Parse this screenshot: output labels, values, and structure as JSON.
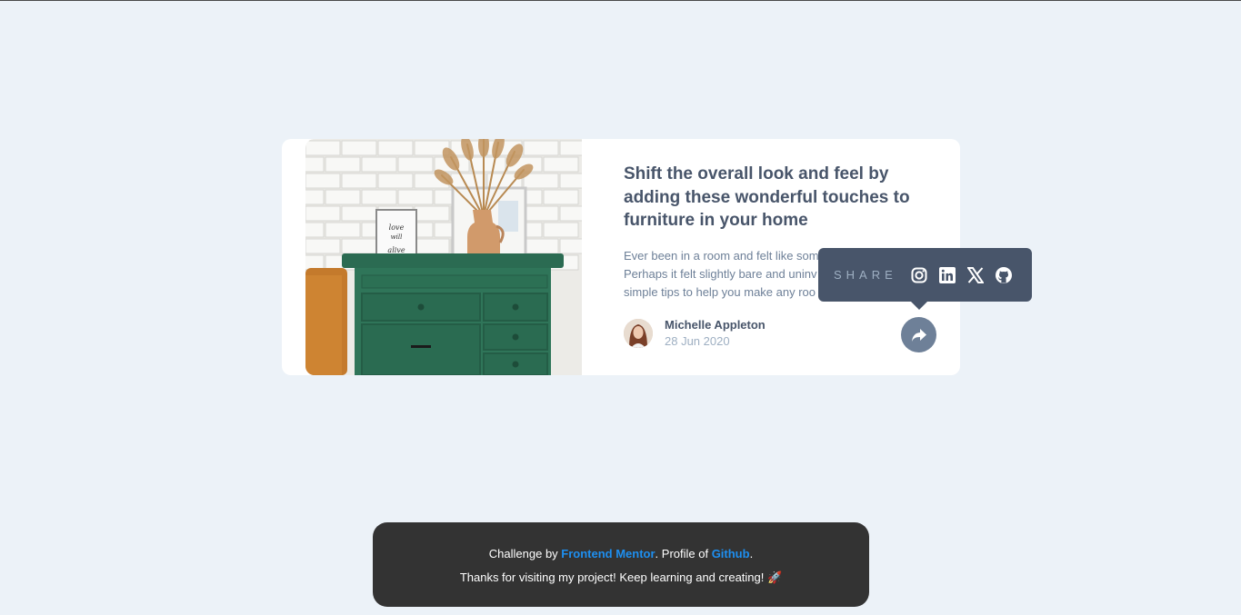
{
  "article": {
    "title": "Shift the overall look and feel by adding these wonderful touches to furniture in your home",
    "excerpt": "Ever been in a room and felt like some",
    "excerpt_line2": "Perhaps it felt slightly bare and uninv",
    "excerpt_line3": "simple tips to help you make any roo",
    "author_name": "Michelle Appleton",
    "date": "28 Jun 2020"
  },
  "share": {
    "label": "SHARE",
    "icons": [
      "instagram-icon",
      "linkedin-icon",
      "x-icon",
      "github-icon"
    ]
  },
  "attribution": {
    "prefix": "Challenge by ",
    "frontend_mentor": "Frontend Mentor",
    "middle": ". Profile of ",
    "github": "Github",
    "suffix": ".",
    "thanks": "Thanks for visiting my project! Keep learning and creating! 🚀"
  },
  "colors": {
    "background": "#ecf2f8",
    "card": "#ffffff",
    "title": "#48556a",
    "text": "#6e8098",
    "muted": "#9eafc2",
    "link": "#1e8ff0",
    "footer": "#333333"
  }
}
